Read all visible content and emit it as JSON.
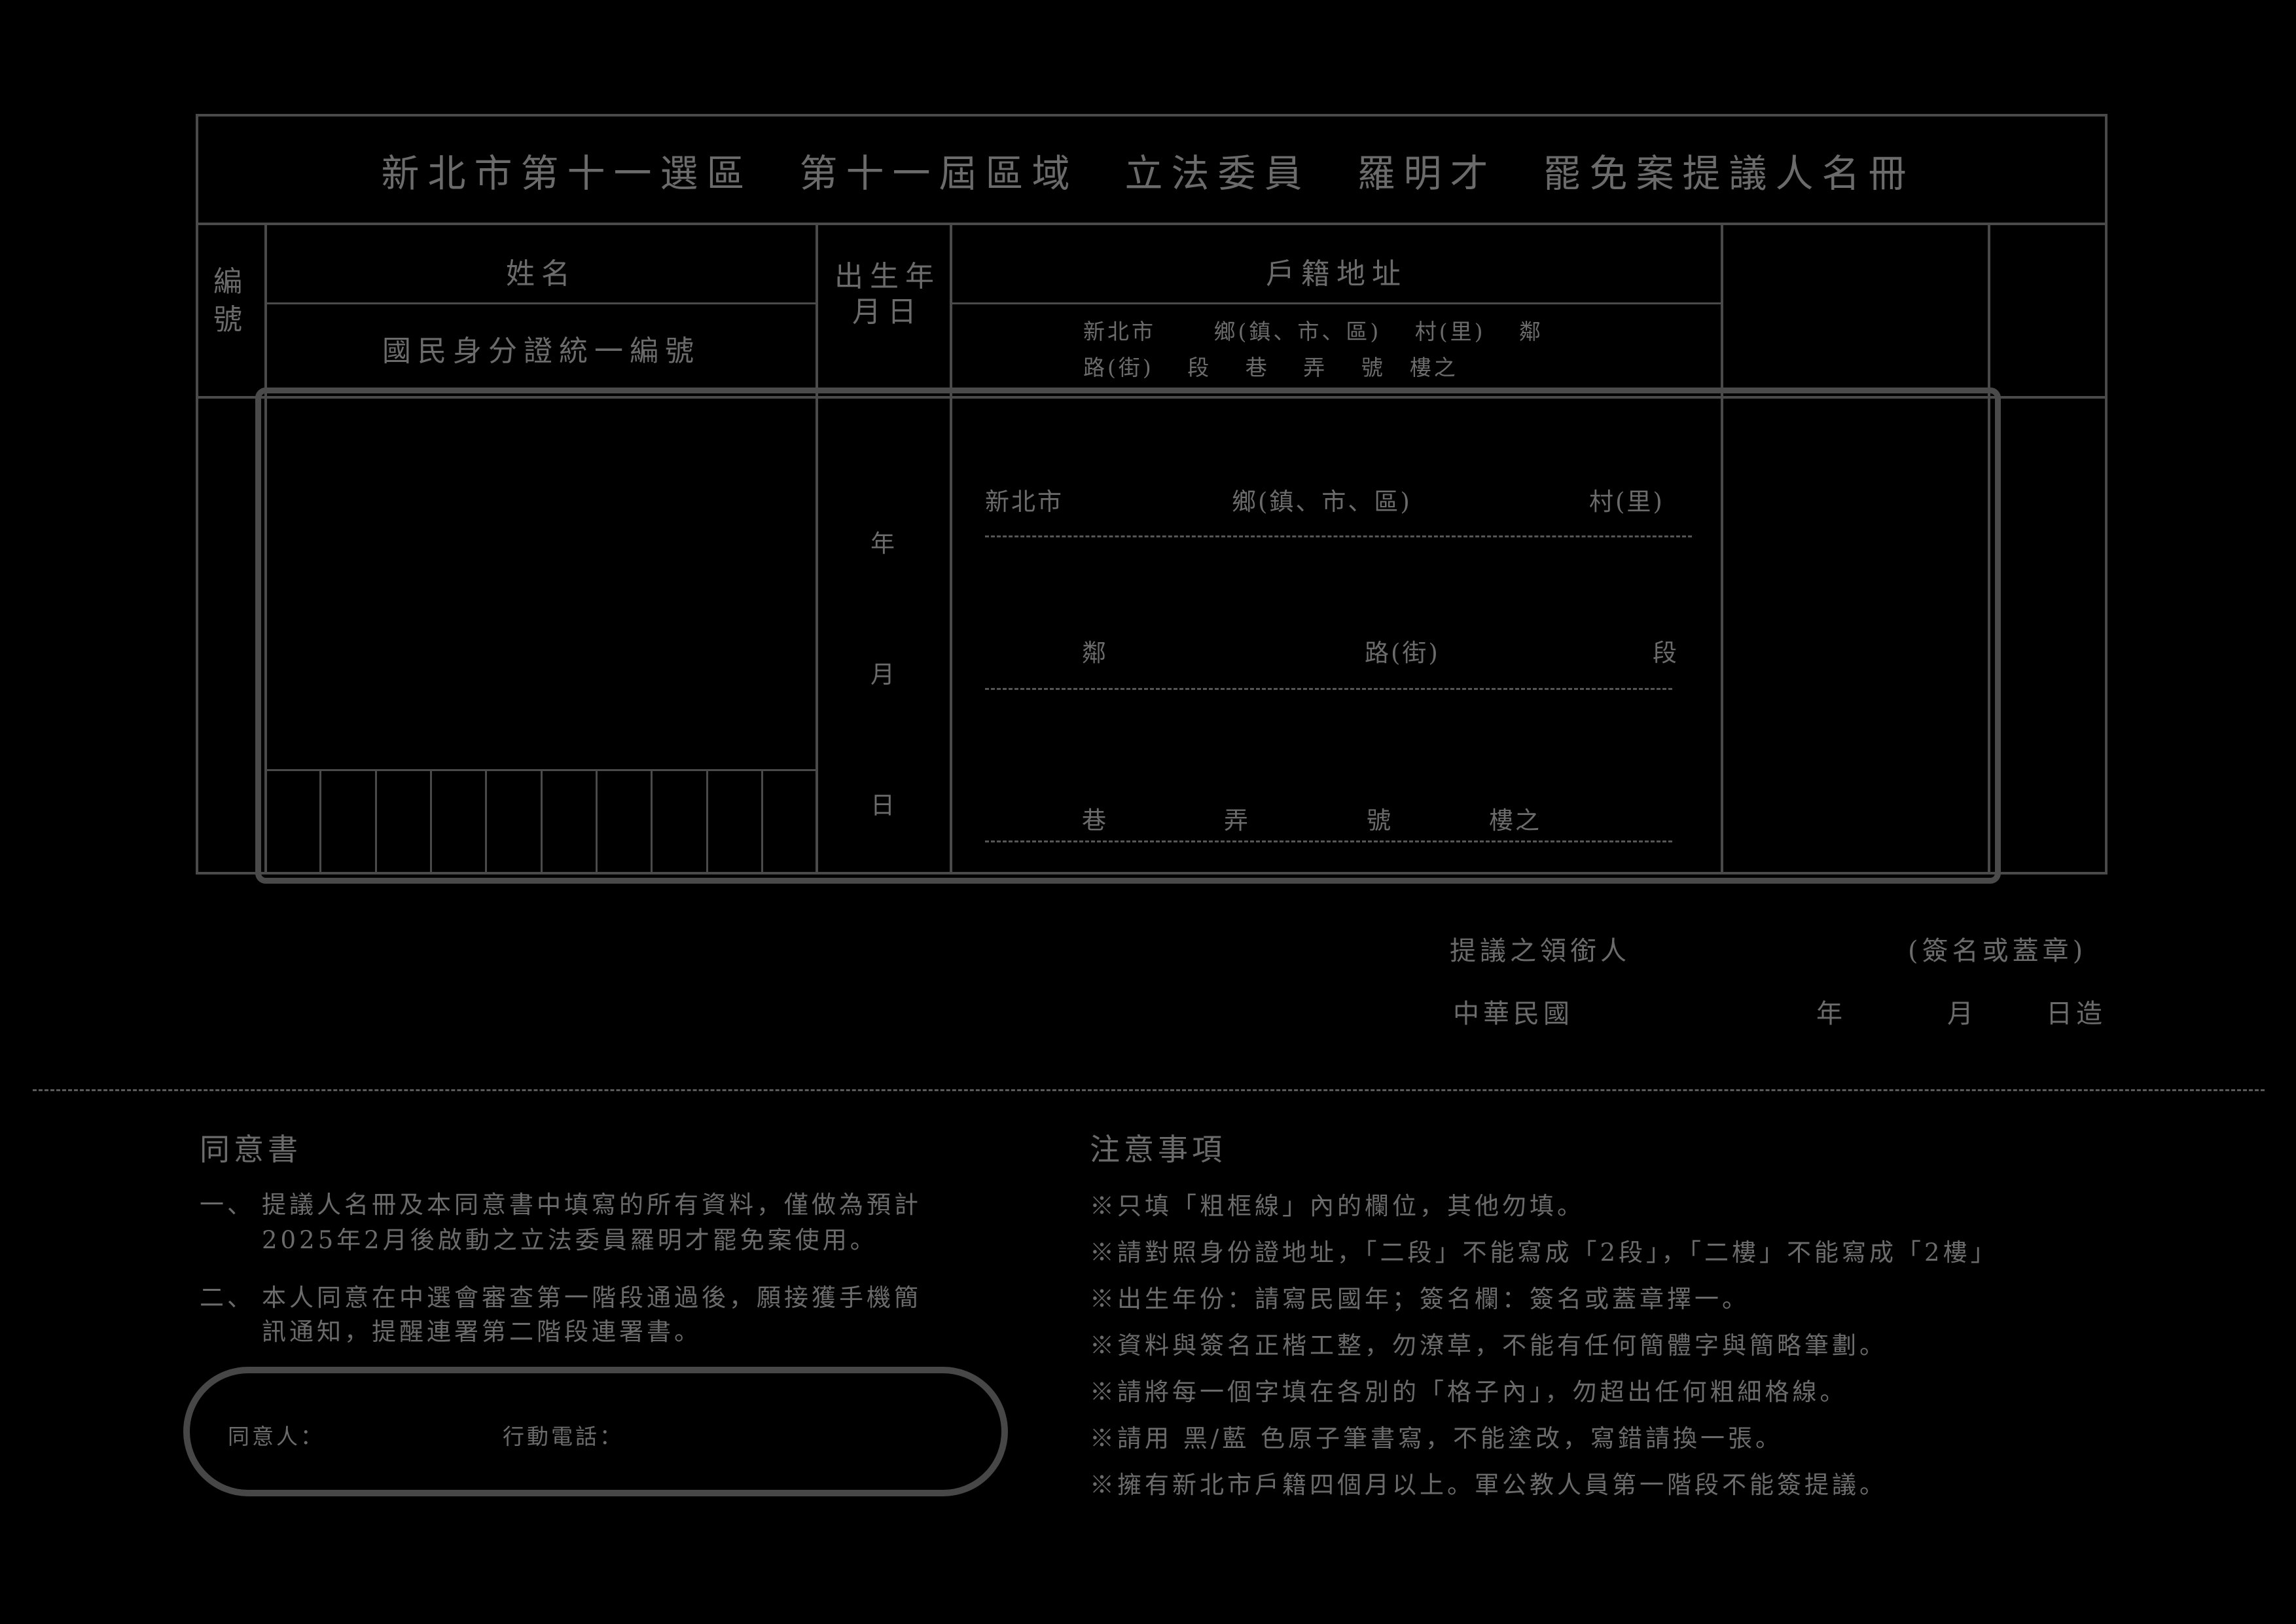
{
  "form": {
    "title": "新北市第十一選區　第十一屆區域　立法委員　羅明才　罷免案提議人名冊",
    "header": {
      "number": "編號",
      "name": "姓名",
      "id_number": "國民身分證統一編號",
      "birth": "出生年月日",
      "address": "戶籍地址",
      "address_line1": "新北市　　 鄉(鎮、市、區)　 村(里)　 鄰",
      "address_line2": "路(街)　 段　 巷　 弄　 號　樓之"
    },
    "row": {
      "year": "年",
      "month": "月",
      "day": "日",
      "addr_city": "新北市",
      "addr_township": "鄉(鎮、市、區)",
      "addr_village": "村(里)",
      "addr_neighborhood": "鄰",
      "addr_road": "路(街)",
      "addr_section": "段",
      "addr_lane": "巷",
      "addr_alley": "弄",
      "addr_number": "號",
      "addr_floor": "樓之"
    },
    "id_box_count": 10
  },
  "sign": {
    "leader_label": "提議之領銜人",
    "leader_hint": "(簽名或蓋章)",
    "roc_label": "中華民國",
    "year": "年",
    "month": "月",
    "day_made": "日造"
  },
  "consent": {
    "title": "同意書",
    "item1_num": "一、",
    "item1_line1": "提議人名冊及本同意書中填寫的所有資料，僅做為預計",
    "item1_line2": "2025年2月後啟動之立法委員羅明才罷免案使用。",
    "item2_num": "二、",
    "item2_line1": "本人同意在中選會審查第一階段通過後，願接獲手機簡",
    "item2_line2": "訊通知，提醒連署第二階段連署書。",
    "consenter_label": "同意人：",
    "phone_label": "行動電話："
  },
  "notes": {
    "title": "注意事項",
    "items": [
      "※只填「粗框線」內的欄位，其他勿填。",
      "※請對照身份證地址，「二段」不能寫成「2段」，「二樓」不能寫成「2樓」",
      "※出生年份：請寫民國年；簽名欄：簽名或蓋章擇一。",
      "※資料與簽名正楷工整，勿潦草，不能有任何簡體字與簡略筆劃。",
      "※請將每一個字填在各別的「格子內」，勿超出任何粗細格線。",
      "※請用 黑/藍 色原子筆書寫，不能塗改，寫錯請換一張。",
      "※擁有新北市戶籍四個月以上。軍公教人員第一階段不能簽提議。"
    ]
  },
  "colors": {
    "background": "#000000",
    "ink": "#6b6b6b",
    "rule": "#4a4a4a"
  }
}
